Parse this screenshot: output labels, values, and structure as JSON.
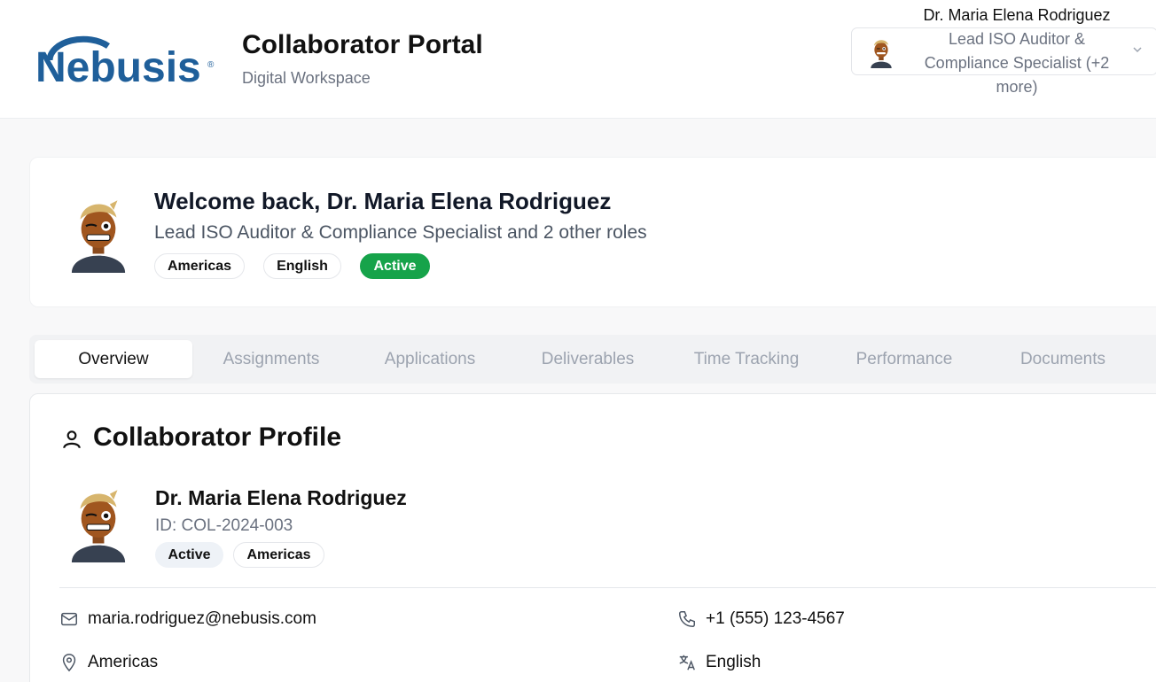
{
  "header": {
    "brand": "Nebusis",
    "title": "Collaborator Portal",
    "subtitle": "Digital Workspace",
    "user_name": "Dr. Maria Elena Rodriguez",
    "role_selector": {
      "line1": "Lead ISO Auditor &",
      "line2": "Compliance Specialist (+2",
      "line3": "more)"
    }
  },
  "welcome": {
    "title": "Welcome back, Dr. Maria Elena Rodriguez",
    "subtitle": "Lead ISO Auditor & Compliance Specialist and 2 other roles",
    "badges": [
      "Americas",
      "English",
      "Active"
    ]
  },
  "tabs": [
    "Overview",
    "Assignments",
    "Applications",
    "Deliverables",
    "Time Tracking",
    "Performance",
    "Documents"
  ],
  "active_tab": "Overview",
  "profile": {
    "heading": "Collaborator Profile",
    "name": "Dr. Maria Elena Rodriguez",
    "id_text": "ID: COL-2024-003",
    "status_chip": "Active",
    "region_chip": "Americas",
    "email": "maria.rodriguez@nebusis.com",
    "phone": "+1 (555) 123-4567",
    "location": "Americas",
    "language": "English"
  },
  "colors": {
    "brand_blue": "#1f5f9a",
    "active_green": "#16a34a",
    "muted_text": "#6b7280"
  },
  "icons": [
    "chevron-down-icon",
    "user-icon",
    "mail-icon",
    "phone-icon",
    "map-pin-icon",
    "translate-icon"
  ]
}
